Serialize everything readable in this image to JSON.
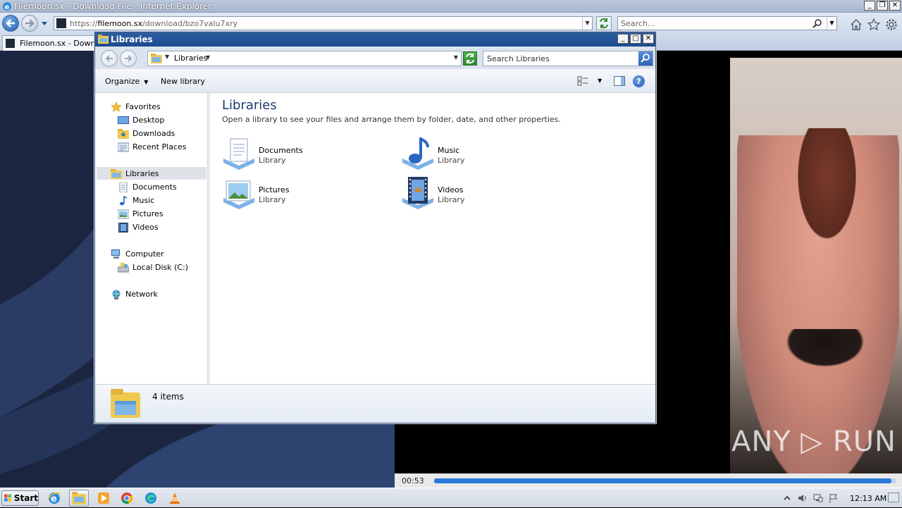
{
  "ie": {
    "title": "Filemoon.sx - Download File - Internet Explorer",
    "url_prefix": "https://",
    "url_host": "filemoon.sx",
    "url_path": "/download/bzo7valu7xry",
    "search_placeholder": "Search...",
    "tab_label": "Filemoon.sx - Downloa..."
  },
  "player": {
    "time": "00:53",
    "progress_fraction": 0.99,
    "watermark": "ANY ▷ RUN"
  },
  "explorer": {
    "title": "Libraries",
    "breadcrumb": "Libraries",
    "search_placeholder": "Search Libraries",
    "toolbar": {
      "organize": "Organize",
      "new_library": "New library"
    },
    "nav": {
      "favorites": "Favorites",
      "desktop": "Desktop",
      "downloads": "Downloads",
      "recent_places": "Recent Places",
      "libraries": "Libraries",
      "documents": "Documents",
      "music": "Music",
      "pictures": "Pictures",
      "videos": "Videos",
      "computer": "Computer",
      "local_disk": "Local Disk (C:)",
      "network": "Network"
    },
    "content": {
      "title": "Libraries",
      "description": "Open a library to see your files and arrange them by folder, date, and other properties.",
      "items": [
        {
          "name": "Documents",
          "type": "Library",
          "icon": "documents-library-icon"
        },
        {
          "name": "Music",
          "type": "Library",
          "icon": "music-library-icon"
        },
        {
          "name": "Pictures",
          "type": "Library",
          "icon": "pictures-library-icon"
        },
        {
          "name": "Videos",
          "type": "Library",
          "icon": "videos-library-icon"
        }
      ]
    },
    "details": {
      "count": "4 items"
    }
  },
  "taskbar": {
    "start": "Start",
    "clock": "12:13 AM",
    "apps": [
      "internet-explorer-icon",
      "explorer-icon",
      "media-player-icon",
      "chrome-icon",
      "edge-icon",
      "vlc-icon"
    ]
  },
  "colors": {
    "explorer_title": "#1c4a8f",
    "accent_blue": "#2b7ad8",
    "content_title": "#1e3a6e"
  }
}
